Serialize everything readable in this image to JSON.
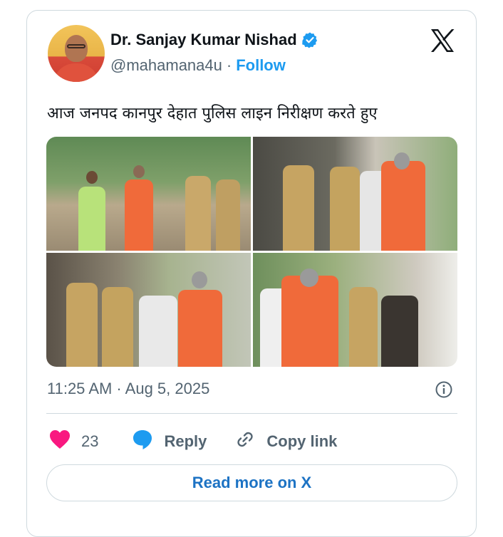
{
  "author": {
    "name": "Dr. Sanjay Kumar Nishad",
    "handle": "@mahamana4u",
    "separator": "·",
    "follow_label": "Follow",
    "verified": true
  },
  "tweet": {
    "text": "आज जनपद कानपुर देहात पुलिस लाइन निरीक्षण करते हुए",
    "photos_count": 4,
    "timestamp": "11:25 AM · Aug 5, 2025"
  },
  "actions": {
    "likes": "23",
    "reply_label": "Reply",
    "copy_label": "Copy link"
  },
  "read_more_label": "Read more on X",
  "icons": {
    "verified": "verified-badge-icon",
    "platform": "x-logo-icon",
    "info": "info-icon",
    "like": "heart-icon",
    "reply": "reply-bubble-icon",
    "copy": "link-icon"
  },
  "colors": {
    "accent": "#1d9bf0",
    "like": "#f91880",
    "muted": "#536471",
    "border": "#cfd9de"
  }
}
